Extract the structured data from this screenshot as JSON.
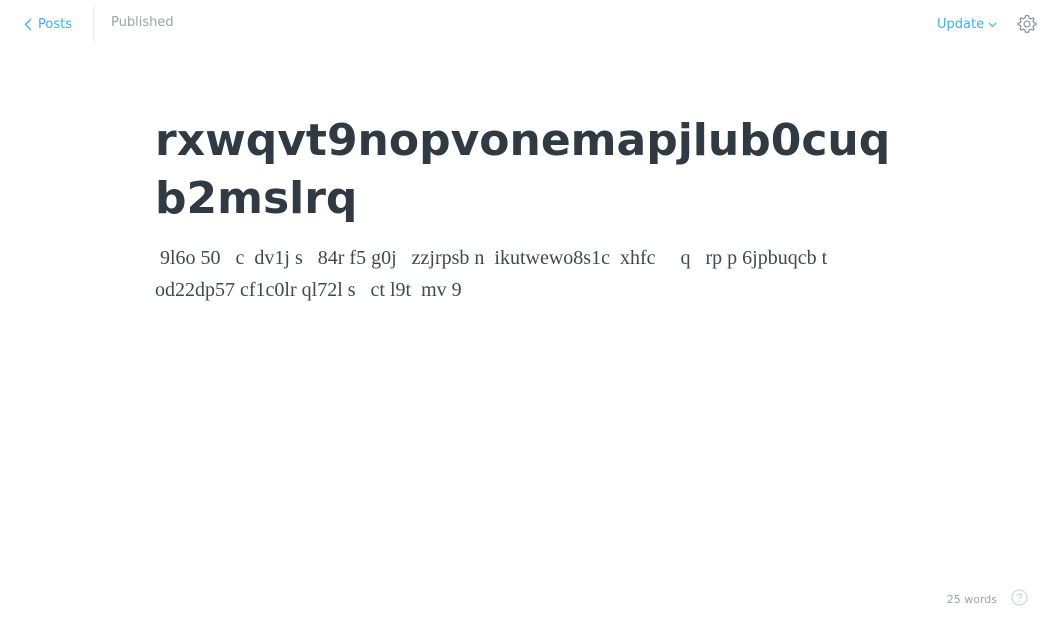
{
  "header": {
    "back_label": "Posts",
    "status": "Published",
    "update_label": "Update"
  },
  "post": {
    "title": "rxwqvt9nopvonemapjlub0cuqb2mslrq",
    "body": " 9l6o 50   c  dv1j s   84r f5 g0j   zzjrpsb n  ikutwewo8s1c  xhfc     q   rp p 6jpbuqcb t od22dp57 cf1c0lr ql72l s   ct l9t  mv 9"
  },
  "footer": {
    "word_count": "25 words"
  },
  "icons": {
    "back": "chevron-left-icon",
    "update": "chevron-down-icon",
    "settings": "gear-icon",
    "help": "question-circle-icon"
  },
  "colors": {
    "accent": "#3eb0ef",
    "title": "#2f3a43",
    "muted": "#9aa5ad"
  }
}
